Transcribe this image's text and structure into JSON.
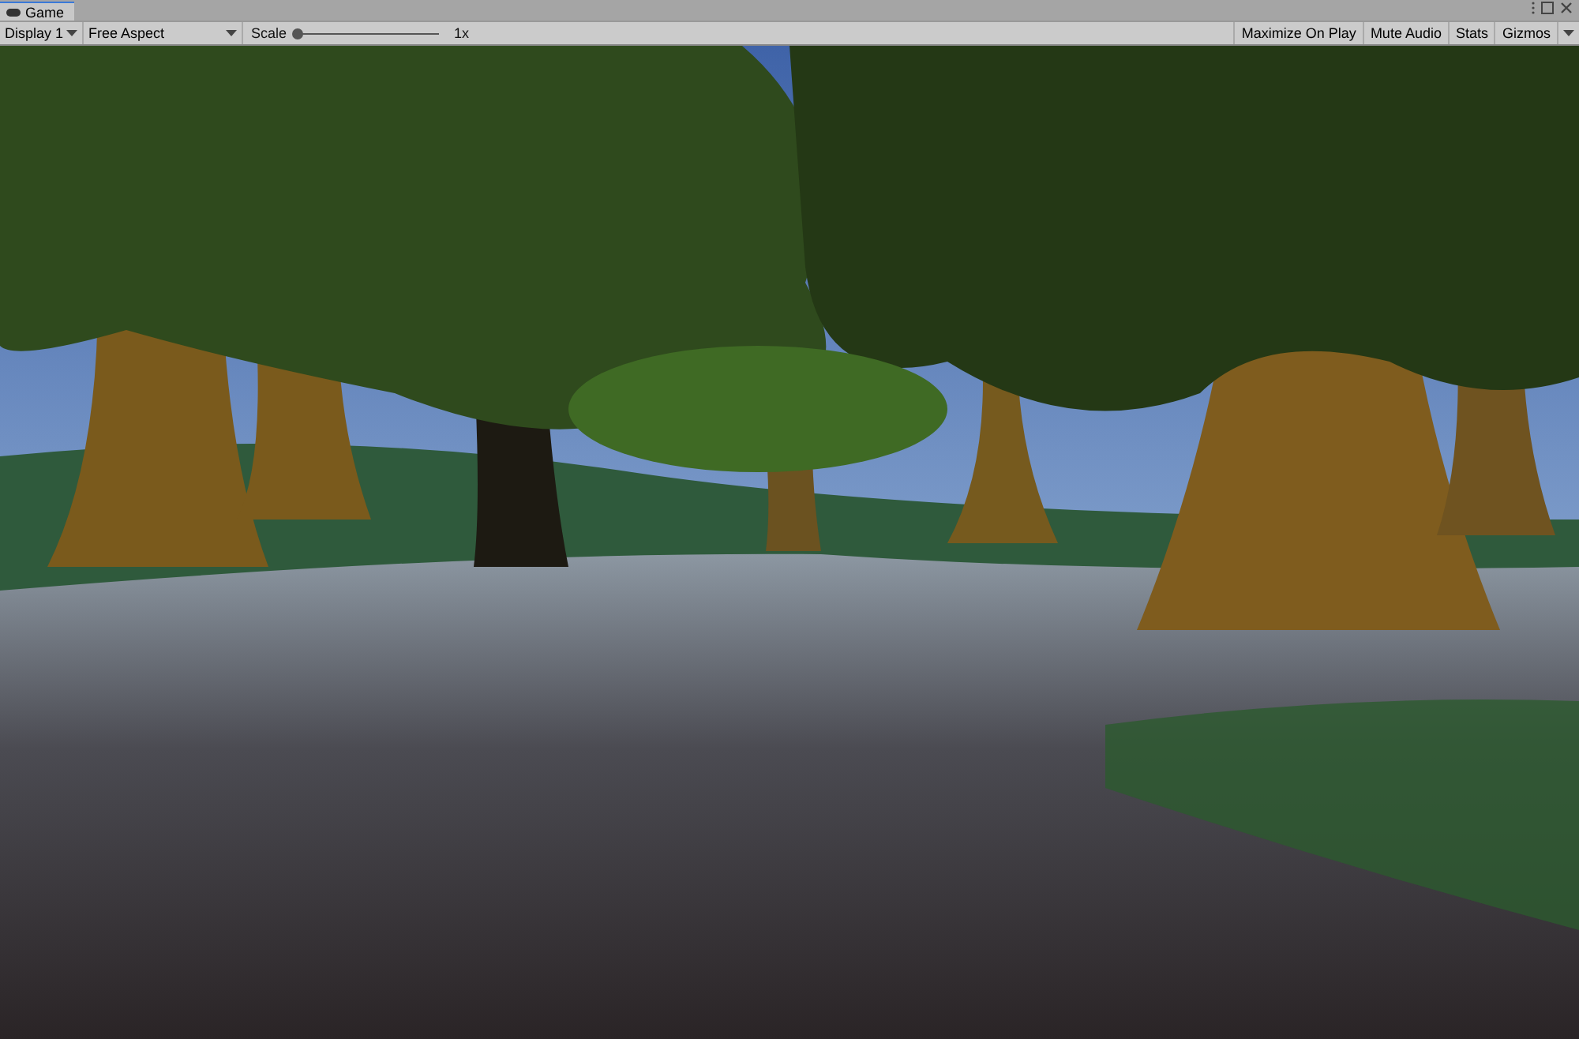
{
  "tab": {
    "label": "Game",
    "selected": true
  },
  "toolbar": {
    "display": "Display 1",
    "aspect": "Free Aspect",
    "scale_label": "Scale",
    "scale": {
      "level": 0
    },
    "scale_value": "1x",
    "toggles": [
      "Maximize On Play",
      "Mute Audio",
      "Stats",
      "Gizmos"
    ]
  }
}
